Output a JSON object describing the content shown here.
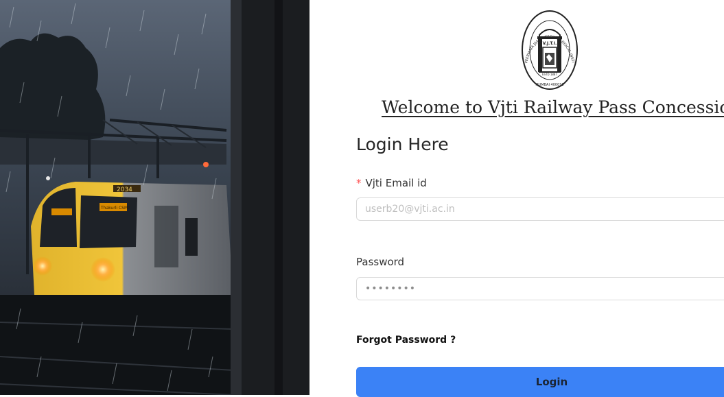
{
  "hero": {
    "train_number": "2034",
    "train_destination": "Thakurli CSMT"
  },
  "logo": {
    "ring_text": "VEERMATA JIJABAI TECHNOLOGICAL INSTITUTE",
    "inner_text": "V.J.T.I.",
    "estd": "ESTD 1887",
    "city": "MUMBAI 400019"
  },
  "header": {
    "welcome": "Welcome to Vjti Railway Pass Concession"
  },
  "form": {
    "title": "Login Here",
    "email": {
      "required_mark": "*",
      "label": "Vjti Email id",
      "placeholder": "userb20@vjti.ac.in"
    },
    "password": {
      "label": "Password",
      "value_masked": "••••••••"
    },
    "forgot_password": "Forgot Password ?",
    "submit_label": "Login"
  },
  "colors": {
    "primary_button": "#3b82f6",
    "required_mark": "#ff4d4f"
  }
}
